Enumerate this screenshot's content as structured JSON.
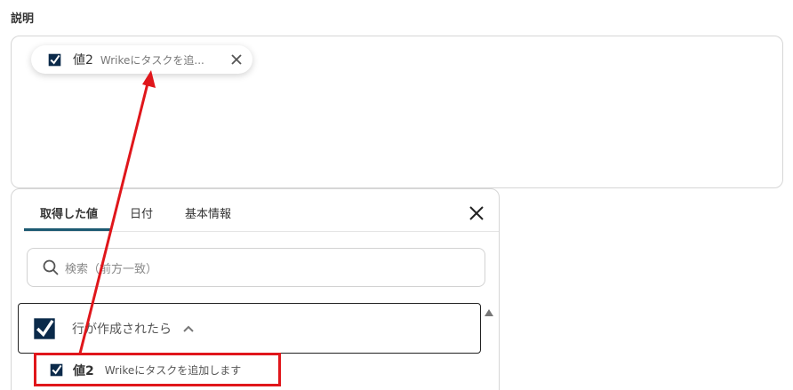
{
  "field": {
    "label": "説明"
  },
  "chip": {
    "name": "値2",
    "value": "Wrikeにタスクを追..."
  },
  "panel": {
    "tabs": [
      {
        "label": "取得した値",
        "active": true
      },
      {
        "label": "日付",
        "active": false
      },
      {
        "label": "基本情報",
        "active": false
      }
    ],
    "search": {
      "placeholder": "検索（前方一致）"
    },
    "group": {
      "title": "行が作成されたら",
      "expanded": true
    },
    "item": {
      "name": "値2",
      "value": "Wrikeにタスクを追加します"
    }
  },
  "colors": {
    "accent": "#1d5a72",
    "annotation": "#e0161b",
    "brand": "#0b2a4a"
  },
  "icons": [
    "smartsheet-icon",
    "close-icon",
    "search-icon",
    "chevron-up-icon",
    "scroll-up-icon"
  ]
}
